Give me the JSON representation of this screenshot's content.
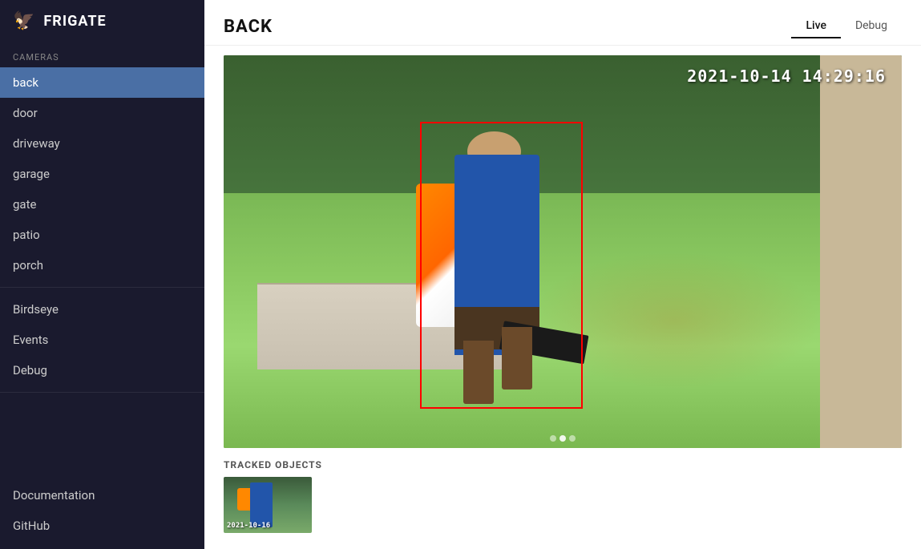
{
  "sidebar": {
    "logo_icon": "🦅",
    "logo_text": "FRIGATE",
    "cameras_label": "Cameras",
    "items": [
      {
        "label": "back",
        "active": true,
        "id": "back"
      },
      {
        "label": "door",
        "active": false,
        "id": "door"
      },
      {
        "label": "driveway",
        "active": false,
        "id": "driveway"
      },
      {
        "label": "garage",
        "active": false,
        "id": "garage"
      },
      {
        "label": "gate",
        "active": false,
        "id": "gate"
      },
      {
        "label": "patio",
        "active": false,
        "id": "patio"
      },
      {
        "label": "porch",
        "active": false,
        "id": "porch"
      }
    ],
    "nav_items": [
      {
        "label": "Birdseye",
        "id": "birdseye"
      },
      {
        "label": "Events",
        "id": "events"
      },
      {
        "label": "Debug",
        "id": "debug"
      }
    ],
    "bottom_items": [
      {
        "label": "Documentation",
        "id": "documentation"
      },
      {
        "label": "GitHub",
        "id": "github"
      }
    ]
  },
  "main": {
    "page_title": "BACK",
    "tabs": [
      {
        "label": "Live",
        "active": true
      },
      {
        "label": "Debug",
        "active": false
      }
    ],
    "video": {
      "timestamp": "2021-10-14 14:29:16"
    },
    "tracked_objects": {
      "section_label": "TRACKED OBJECTS",
      "thumb_timestamp": "2021-10-16"
    }
  }
}
